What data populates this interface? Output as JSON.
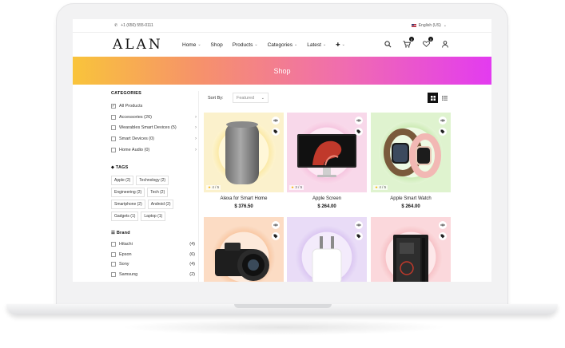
{
  "topbar": {
    "phone": "+1 (650) 555-0111",
    "language": "English (US)"
  },
  "header": {
    "logo": "ALAN",
    "nav": [
      {
        "label": "Home",
        "has_dropdown": true
      },
      {
        "label": "Shop",
        "has_dropdown": false
      },
      {
        "label": "Products",
        "has_dropdown": true
      },
      {
        "label": "Categories",
        "has_dropdown": true
      },
      {
        "label": "Latest",
        "has_dropdown": true
      },
      {
        "label": "✚",
        "has_dropdown": true
      }
    ],
    "cart_count": "0",
    "wishlist_count": "0"
  },
  "banner": {
    "title": "Shop"
  },
  "sidebar": {
    "categories_title": "CATEGORIES",
    "categories": [
      {
        "label": "All Products",
        "checked": true
      },
      {
        "label": "Accessories (26)"
      },
      {
        "label": "Wearables Smart Devices (5)"
      },
      {
        "label": "Smart Devices (0)"
      },
      {
        "label": "Home Audio (0)"
      }
    ],
    "tags_title": "TAGS",
    "tags": [
      "Apple (2)",
      "Technology (2)",
      "Engineering (2)",
      "Tech (2)",
      "Smartphone (2)",
      "Android (2)",
      "Gadgets (1)",
      "Laptop (1)"
    ],
    "brand_title": "Brand",
    "brands": [
      {
        "name": "Hitachi",
        "count": "(4)"
      },
      {
        "name": "Epson",
        "count": "(6)"
      },
      {
        "name": "Sony",
        "count": "(4)"
      },
      {
        "name": "Samsung",
        "count": "(2)"
      }
    ]
  },
  "sortbar": {
    "label": "Sort By:",
    "selected": "Featured"
  },
  "products": [
    {
      "name": "Alexa for Smart Home",
      "price": "$ 376.50",
      "rating": "4 / 5"
    },
    {
      "name": "Apple Screen",
      "price": "$ 264.00",
      "rating": "3 / 5"
    },
    {
      "name": "Apple Smart Watch",
      "price": "$ 264.00",
      "rating": "4 / 5"
    },
    {
      "name": "",
      "price": "",
      "rating": ""
    },
    {
      "name": "",
      "price": "",
      "rating": ""
    },
    {
      "name": "",
      "price": "",
      "rating": ""
    }
  ],
  "colors": {
    "banner_start": "#f9c43b",
    "banner_end": "#e33bf0",
    "star": "#f5b301"
  }
}
